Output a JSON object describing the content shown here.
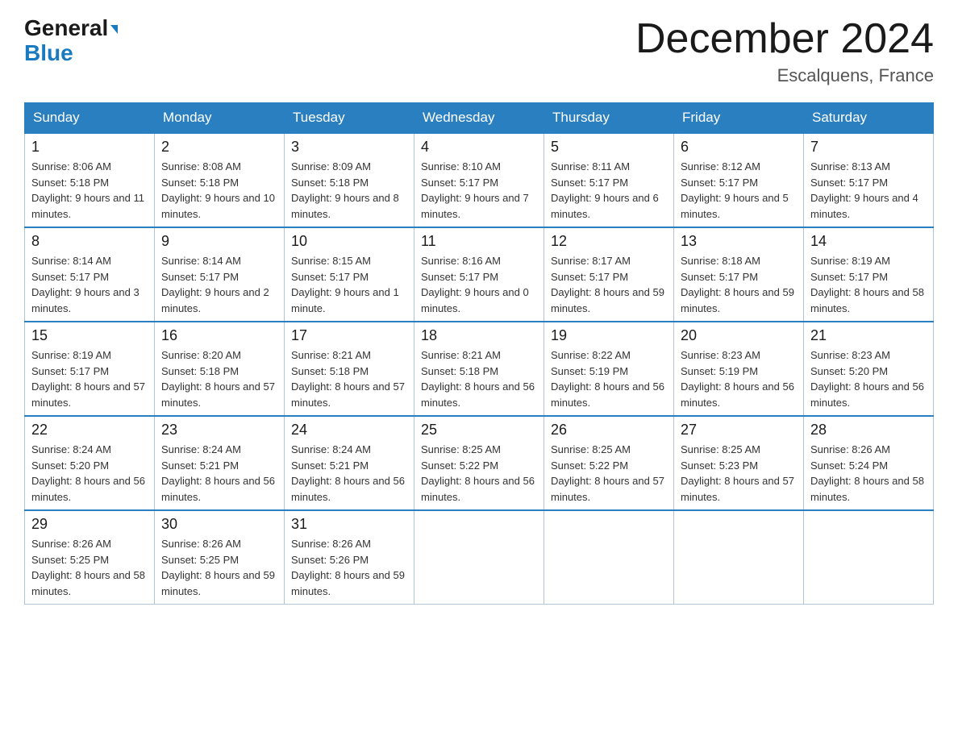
{
  "logo": {
    "general": "General",
    "arrow": "▶",
    "blue": "Blue"
  },
  "header": {
    "month_year": "December 2024",
    "location": "Escalquens, France"
  },
  "days_of_week": [
    "Sunday",
    "Monday",
    "Tuesday",
    "Wednesday",
    "Thursday",
    "Friday",
    "Saturday"
  ],
  "weeks": [
    [
      {
        "day": "1",
        "sunrise": "Sunrise: 8:06 AM",
        "sunset": "Sunset: 5:18 PM",
        "daylight": "Daylight: 9 hours and 11 minutes."
      },
      {
        "day": "2",
        "sunrise": "Sunrise: 8:08 AM",
        "sunset": "Sunset: 5:18 PM",
        "daylight": "Daylight: 9 hours and 10 minutes."
      },
      {
        "day": "3",
        "sunrise": "Sunrise: 8:09 AM",
        "sunset": "Sunset: 5:18 PM",
        "daylight": "Daylight: 9 hours and 8 minutes."
      },
      {
        "day": "4",
        "sunrise": "Sunrise: 8:10 AM",
        "sunset": "Sunset: 5:17 PM",
        "daylight": "Daylight: 9 hours and 7 minutes."
      },
      {
        "day": "5",
        "sunrise": "Sunrise: 8:11 AM",
        "sunset": "Sunset: 5:17 PM",
        "daylight": "Daylight: 9 hours and 6 minutes."
      },
      {
        "day": "6",
        "sunrise": "Sunrise: 8:12 AM",
        "sunset": "Sunset: 5:17 PM",
        "daylight": "Daylight: 9 hours and 5 minutes."
      },
      {
        "day": "7",
        "sunrise": "Sunrise: 8:13 AM",
        "sunset": "Sunset: 5:17 PM",
        "daylight": "Daylight: 9 hours and 4 minutes."
      }
    ],
    [
      {
        "day": "8",
        "sunrise": "Sunrise: 8:14 AM",
        "sunset": "Sunset: 5:17 PM",
        "daylight": "Daylight: 9 hours and 3 minutes."
      },
      {
        "day": "9",
        "sunrise": "Sunrise: 8:14 AM",
        "sunset": "Sunset: 5:17 PM",
        "daylight": "Daylight: 9 hours and 2 minutes."
      },
      {
        "day": "10",
        "sunrise": "Sunrise: 8:15 AM",
        "sunset": "Sunset: 5:17 PM",
        "daylight": "Daylight: 9 hours and 1 minute."
      },
      {
        "day": "11",
        "sunrise": "Sunrise: 8:16 AM",
        "sunset": "Sunset: 5:17 PM",
        "daylight": "Daylight: 9 hours and 0 minutes."
      },
      {
        "day": "12",
        "sunrise": "Sunrise: 8:17 AM",
        "sunset": "Sunset: 5:17 PM",
        "daylight": "Daylight: 8 hours and 59 minutes."
      },
      {
        "day": "13",
        "sunrise": "Sunrise: 8:18 AM",
        "sunset": "Sunset: 5:17 PM",
        "daylight": "Daylight: 8 hours and 59 minutes."
      },
      {
        "day": "14",
        "sunrise": "Sunrise: 8:19 AM",
        "sunset": "Sunset: 5:17 PM",
        "daylight": "Daylight: 8 hours and 58 minutes."
      }
    ],
    [
      {
        "day": "15",
        "sunrise": "Sunrise: 8:19 AM",
        "sunset": "Sunset: 5:17 PM",
        "daylight": "Daylight: 8 hours and 57 minutes."
      },
      {
        "day": "16",
        "sunrise": "Sunrise: 8:20 AM",
        "sunset": "Sunset: 5:18 PM",
        "daylight": "Daylight: 8 hours and 57 minutes."
      },
      {
        "day": "17",
        "sunrise": "Sunrise: 8:21 AM",
        "sunset": "Sunset: 5:18 PM",
        "daylight": "Daylight: 8 hours and 57 minutes."
      },
      {
        "day": "18",
        "sunrise": "Sunrise: 8:21 AM",
        "sunset": "Sunset: 5:18 PM",
        "daylight": "Daylight: 8 hours and 56 minutes."
      },
      {
        "day": "19",
        "sunrise": "Sunrise: 8:22 AM",
        "sunset": "Sunset: 5:19 PM",
        "daylight": "Daylight: 8 hours and 56 minutes."
      },
      {
        "day": "20",
        "sunrise": "Sunrise: 8:23 AM",
        "sunset": "Sunset: 5:19 PM",
        "daylight": "Daylight: 8 hours and 56 minutes."
      },
      {
        "day": "21",
        "sunrise": "Sunrise: 8:23 AM",
        "sunset": "Sunset: 5:20 PM",
        "daylight": "Daylight: 8 hours and 56 minutes."
      }
    ],
    [
      {
        "day": "22",
        "sunrise": "Sunrise: 8:24 AM",
        "sunset": "Sunset: 5:20 PM",
        "daylight": "Daylight: 8 hours and 56 minutes."
      },
      {
        "day": "23",
        "sunrise": "Sunrise: 8:24 AM",
        "sunset": "Sunset: 5:21 PM",
        "daylight": "Daylight: 8 hours and 56 minutes."
      },
      {
        "day": "24",
        "sunrise": "Sunrise: 8:24 AM",
        "sunset": "Sunset: 5:21 PM",
        "daylight": "Daylight: 8 hours and 56 minutes."
      },
      {
        "day": "25",
        "sunrise": "Sunrise: 8:25 AM",
        "sunset": "Sunset: 5:22 PM",
        "daylight": "Daylight: 8 hours and 56 minutes."
      },
      {
        "day": "26",
        "sunrise": "Sunrise: 8:25 AM",
        "sunset": "Sunset: 5:22 PM",
        "daylight": "Daylight: 8 hours and 57 minutes."
      },
      {
        "day": "27",
        "sunrise": "Sunrise: 8:25 AM",
        "sunset": "Sunset: 5:23 PM",
        "daylight": "Daylight: 8 hours and 57 minutes."
      },
      {
        "day": "28",
        "sunrise": "Sunrise: 8:26 AM",
        "sunset": "Sunset: 5:24 PM",
        "daylight": "Daylight: 8 hours and 58 minutes."
      }
    ],
    [
      {
        "day": "29",
        "sunrise": "Sunrise: 8:26 AM",
        "sunset": "Sunset: 5:25 PM",
        "daylight": "Daylight: 8 hours and 58 minutes."
      },
      {
        "day": "30",
        "sunrise": "Sunrise: 8:26 AM",
        "sunset": "Sunset: 5:25 PM",
        "daylight": "Daylight: 8 hours and 59 minutes."
      },
      {
        "day": "31",
        "sunrise": "Sunrise: 8:26 AM",
        "sunset": "Sunset: 5:26 PM",
        "daylight": "Daylight: 8 hours and 59 minutes."
      },
      null,
      null,
      null,
      null
    ]
  ]
}
